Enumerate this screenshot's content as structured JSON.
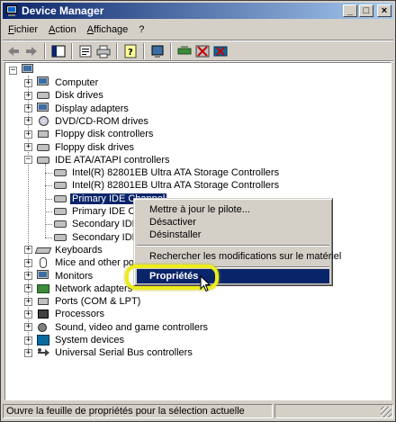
{
  "window": {
    "title": "Device Manager"
  },
  "menubar": [
    "Fichier",
    "Action",
    "Affichage",
    "?"
  ],
  "toolbar": [
    "back-arrow",
    "forward-arrow",
    "up-pane",
    "properties",
    "print",
    "help",
    "scan",
    "update",
    "uninstall",
    "disable"
  ],
  "tree": {
    "root": "",
    "categories": [
      {
        "label": "Computer",
        "icon": "computer-icon",
        "expanded": false
      },
      {
        "label": "Disk drives",
        "icon": "disk-drive-icon",
        "expanded": false
      },
      {
        "label": "Display adapters",
        "icon": "monitor-icon",
        "expanded": false
      },
      {
        "label": "DVD/CD-ROM drives",
        "icon": "cdrom-icon",
        "expanded": false
      },
      {
        "label": "Floppy disk controllers",
        "icon": "controller-icon",
        "expanded": false
      },
      {
        "label": "Floppy disk drives",
        "icon": "floppy-icon",
        "expanded": false
      },
      {
        "label": "IDE ATA/ATAPI controllers",
        "icon": "ide-icon",
        "expanded": true,
        "children": [
          "Intel(R) 82801EB Ultra ATA Storage Controllers",
          "Intel(R) 82801EB Ultra ATA Storage Controllers",
          "Primary IDE Channel",
          "Primary IDE Chan",
          "Secondary IDE C",
          "Secondary IDE C"
        ]
      },
      {
        "label": "Keyboards",
        "icon": "keyboard-icon",
        "expanded": false
      },
      {
        "label": "Mice and other pointi",
        "icon": "mouse-icon",
        "expanded": false
      },
      {
        "label": "Monitors",
        "icon": "monitor-icon",
        "expanded": false
      },
      {
        "label": "Network adapters",
        "icon": "network-icon",
        "expanded": false
      },
      {
        "label": "Ports (COM & LPT)",
        "icon": "port-icon",
        "expanded": false
      },
      {
        "label": "Processors",
        "icon": "processor-icon",
        "expanded": false
      },
      {
        "label": "Sound, video and game controllers",
        "icon": "sound-icon",
        "expanded": false
      },
      {
        "label": "System devices",
        "icon": "system-icon",
        "expanded": false
      },
      {
        "label": "Universal Serial Bus controllers",
        "icon": "usb-icon",
        "expanded": false
      }
    ]
  },
  "context_menu": {
    "items": [
      "Mettre à jour le pilote...",
      "Désactiver",
      "Désinstaller",
      "Rechercher les modifications sur le matériel",
      "Propriétés"
    ],
    "highlighted": "Propriétés"
  },
  "statusbar": {
    "text": "Ouvre la feuille de propriétés pour la sélection actuelle"
  },
  "colors": {
    "title_start": "#0a246a",
    "title_end": "#a6caf0",
    "selection": "#0a246a",
    "highlight_ring": "#ecec1e"
  }
}
